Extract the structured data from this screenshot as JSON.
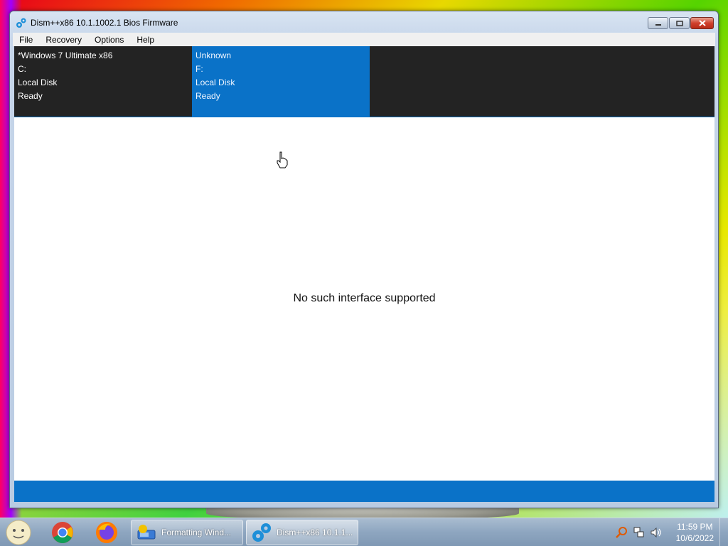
{
  "window": {
    "title": "Dism++x86 10.1.1002.1 Bios Firmware",
    "icon": "gear-icon"
  },
  "menu": [
    "File",
    "Recovery",
    "Options",
    "Help"
  ],
  "disks": [
    {
      "name": "*Windows 7 Ultimate x86",
      "drive": "C:",
      "type": "Local Disk",
      "status": "Ready",
      "selected": false
    },
    {
      "name": "Unknown",
      "drive": "F:",
      "type": "Local Disk",
      "status": "Ready",
      "selected": true
    }
  ],
  "content": {
    "message": "No such interface supported"
  },
  "taskbar": {
    "pinned": [
      "chrome-icon",
      "firefox-icon"
    ],
    "tasks": [
      {
        "label": "Formatting Wind...",
        "icon": "disk-format-icon",
        "active": false
      },
      {
        "label": "Dism++x86 10.1.1...",
        "icon": "gear-icon",
        "active": true
      }
    ],
    "clock": {
      "time": "11:59 PM",
      "date": "10/6/2022"
    }
  },
  "colors": {
    "accent": "#0a72c8",
    "strip_bg": "#232323"
  }
}
